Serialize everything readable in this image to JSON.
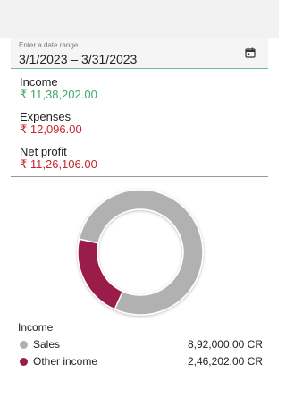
{
  "date_range": {
    "label": "Enter a date range",
    "value": "3/1/2023 – 3/31/2023"
  },
  "summary": {
    "income_label": "Income",
    "income_value": "₹ 11,38,202.00",
    "expenses_label": "Expenses",
    "expenses_value": "₹ 12,096.00",
    "net_label": "Net profit",
    "net_value": "₹ 11,26,106.00"
  },
  "colors": {
    "income_value": "#3fa86a",
    "negative_value": "#c6262e",
    "sales": "#b1b1b1",
    "other_income": "#9a1b4a"
  },
  "income_table": {
    "title": "Income",
    "rows": [
      {
        "label": "Sales",
        "value": "8,92,000.00 CR"
      },
      {
        "label": "Other income",
        "value": "2,46,202.00 CR"
      }
    ]
  },
  "chart_data": {
    "type": "pie",
    "subtype": "donut",
    "categories": [
      "Sales",
      "Other income"
    ],
    "values": [
      892000,
      246202
    ],
    "colors": [
      "#b1b1b1",
      "#9a1b4a"
    ]
  }
}
